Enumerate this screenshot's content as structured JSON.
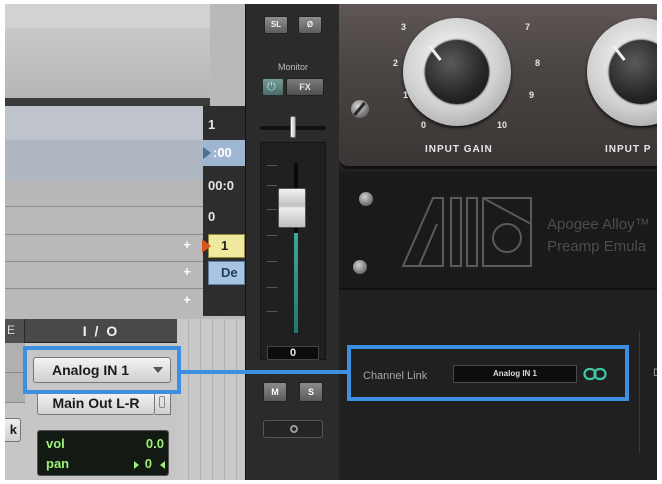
{
  "edit_window": {
    "ruler": {
      "row1": "1",
      "row2": ":00",
      "row3": "00:0",
      "row4": "0"
    },
    "regions": {
      "region_a": "1",
      "region_b": "De"
    },
    "plus_glyph": "+"
  },
  "mix_window": {
    "io_header": "I / O",
    "left_header": "E",
    "input_selector": "Analog IN 1",
    "output_selector": "Main Out L-R",
    "side_button": "k",
    "volume": {
      "label": "vol",
      "value": "0.0"
    },
    "pan": {
      "label": "pan",
      "value": "0"
    }
  },
  "plugin_strip": {
    "sl_button": "SL",
    "phase_button": "Ø",
    "monitor_label": "Monitor",
    "power_symbol": "⏻",
    "fx_button": "FX",
    "fader_value": "0",
    "mute_button": "M",
    "solo_button": "S"
  },
  "plugin": {
    "knob1": {
      "caption": "INPUT GAIN",
      "scale": [
        "0",
        "1",
        "2",
        "3",
        "7",
        "8",
        "9",
        "10"
      ]
    },
    "knob2": {
      "caption": "INPUT P"
    },
    "brand": {
      "line1": "Apogee Alloy™",
      "line2": "Preamp Emula"
    },
    "channel_link": {
      "label": "Channel Link",
      "value": "Analog IN 1",
      "icon": "chain-link-icon"
    },
    "edge_text": "D"
  },
  "highlight_color": "#3d8fe1"
}
